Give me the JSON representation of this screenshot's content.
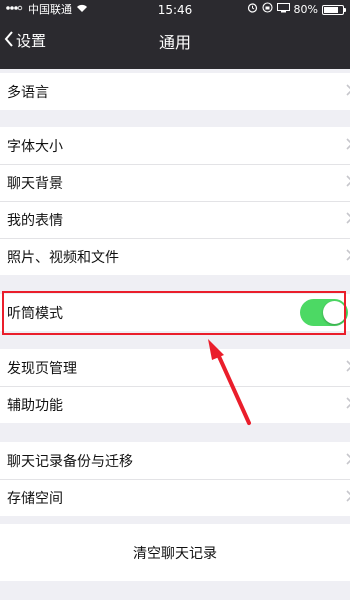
{
  "status": {
    "carrier": "中国联通",
    "time": "15:46",
    "battery": "80%",
    "battery_level": 0.8
  },
  "nav": {
    "back_label": "设置",
    "title": "通用"
  },
  "sections": {
    "s1": [
      "多语言"
    ],
    "s2": [
      "字体大小",
      "聊天背景",
      "我的表情",
      "照片、视频和文件"
    ],
    "s3": {
      "label": "听筒模式",
      "toggle_on": true
    },
    "s4": [
      "发现页管理",
      "辅助功能"
    ],
    "s5": [
      "聊天记录备份与迁移",
      "存储空间"
    ],
    "s6": "清空聊天记录"
  },
  "colors": {
    "toggle_on": "#4cd964",
    "annotation": "#ea1e2b"
  }
}
